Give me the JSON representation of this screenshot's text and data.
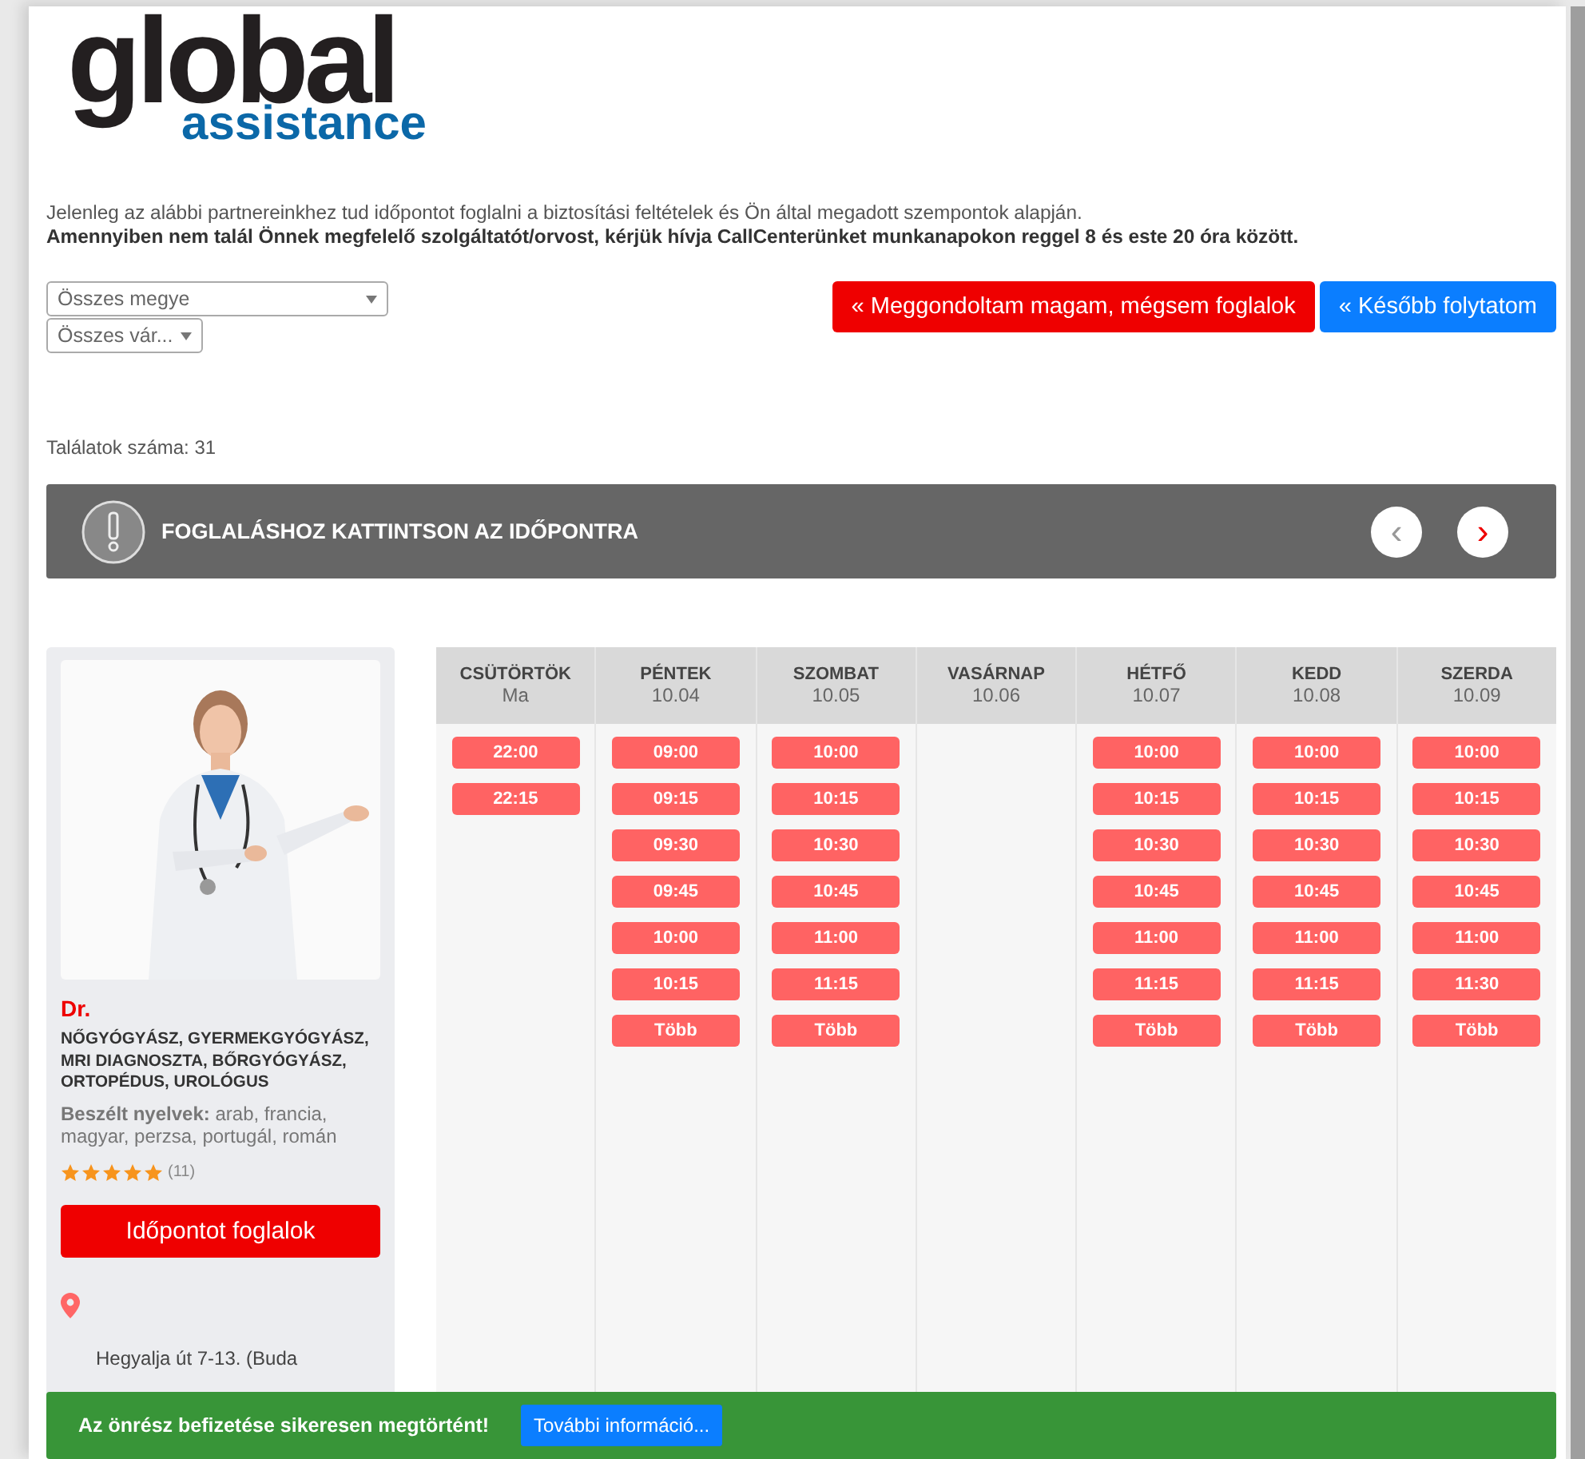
{
  "logo": {
    "word_1": "global",
    "word_2": "assistance"
  },
  "intro": {
    "line_1": "Jelenleg az alábbi partnereinkhez tud időpontot foglalni a biztosítási feltételek és Ön által megadott szempontok alapján.",
    "line_2": "Amennyiben nem talál Önnek megfelelő szolgáltatót/orvost, kérjük hívja CallCenterünket munkanapokon reggel 8 és este 20 óra között."
  },
  "filters": [
    {
      "value": "Összes megye"
    },
    {
      "value": "Összes vár..."
    }
  ],
  "actions": [
    {
      "label": "« Meggondoltam magam, mégsem foglalok",
      "kind": "danger"
    },
    {
      "label": "« Később folytatom",
      "kind": "primary"
    }
  ],
  "results_count": "Találatok száma: 31",
  "notice": {
    "text": "FOGLALÁSHOZ KATTINTSON AZ IDŐPONTRA",
    "prev": "‹",
    "next": "›"
  },
  "doctor": {
    "name": "Dr.",
    "specialties": "NŐGYÓGYÁSZ, GYERMEKGYÓGYÁSZ, MRI DIAGNOSZTA, BŐRGYÓGYÁSZ, ORTOPÉDUS, UROLÓGUS",
    "languages_label": "Beszélt nyelvek:",
    "languages": "arab, francia, magyar, perzsa, portugál, román",
    "stars": 5,
    "review_count": "(11)",
    "book_button": "Időpontot foglalok",
    "address": "Hegyalja út 7-13. (Buda"
  },
  "days": [
    {
      "day": "CSÜTÖRTÖK",
      "date": "Ma",
      "slots": [
        "22:00",
        "22:15"
      ]
    },
    {
      "day": "PÉNTEK",
      "date": "10.04",
      "slots": [
        "09:00",
        "09:15",
        "09:30",
        "09:45",
        "10:00",
        "10:15",
        "Több"
      ]
    },
    {
      "day": "SZOMBAT",
      "date": "10.05",
      "slots": [
        "10:00",
        "10:15",
        "10:30",
        "10:45",
        "11:00",
        "11:15",
        "Több"
      ]
    },
    {
      "day": "VASÁRNAP",
      "date": "10.06"
    },
    {
      "day": "HÉTFŐ",
      "date": "10.07",
      "slots": [
        "10:00",
        "10:15",
        "10:30",
        "10:45",
        "11:00",
        "11:15",
        "Több"
      ]
    },
    {
      "day": "KEDD",
      "date": "10.08",
      "slots": [
        "10:00",
        "10:15",
        "10:30",
        "10:45",
        "11:00",
        "11:15",
        "Több"
      ]
    },
    {
      "day": "SZERDA",
      "date": "10.09",
      "slots": [
        "10:00",
        "10:15",
        "10:30",
        "10:45",
        "11:00",
        "11:30",
        "Több"
      ]
    }
  ],
  "banner": {
    "text": "Az önrész befizetése sikeresen megtörtént!",
    "button": "További információ..."
  }
}
